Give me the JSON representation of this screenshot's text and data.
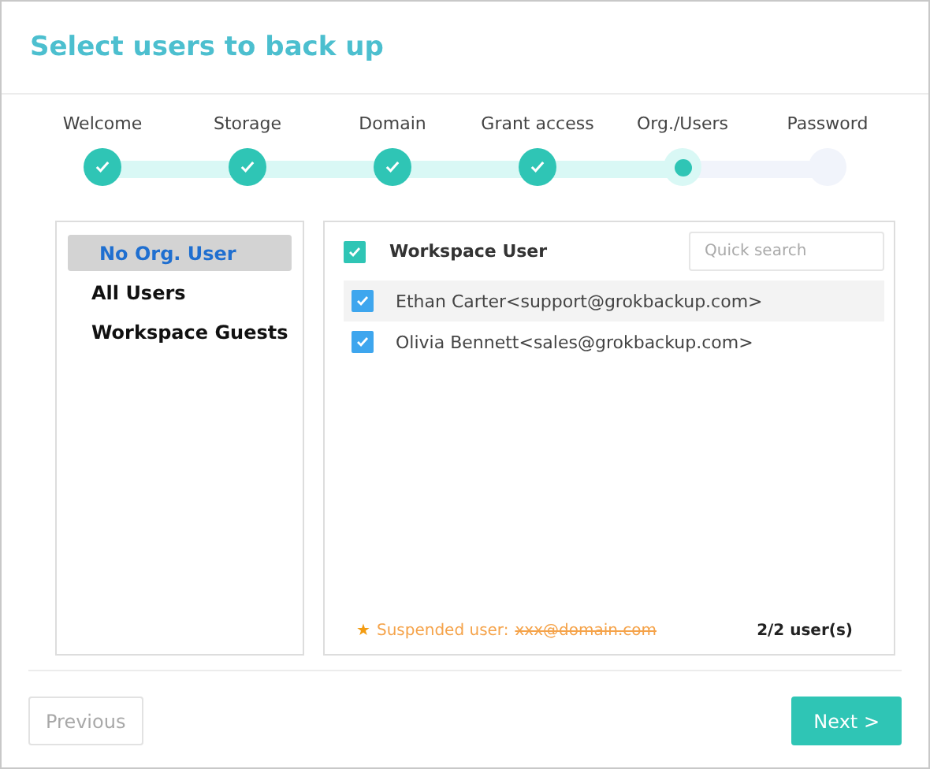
{
  "title": "Select users to back up",
  "steps": [
    {
      "label": "Welcome",
      "kind": "done"
    },
    {
      "label": "Storage",
      "kind": "done"
    },
    {
      "label": "Domain",
      "kind": "done"
    },
    {
      "label": "Grant access",
      "kind": "done"
    },
    {
      "label": "Org./Users",
      "kind": "current"
    },
    {
      "label": "Password",
      "kind": "pending"
    }
  ],
  "sidebar": {
    "items": [
      {
        "label": "No Org. User",
        "selected": true
      },
      {
        "label": "All Users",
        "selected": false
      },
      {
        "label": "Workspace Guests",
        "selected": false
      }
    ]
  },
  "user_list": {
    "header": {
      "label": "Workspace User",
      "checked": true
    },
    "search": {
      "placeholder": "Quick search"
    },
    "rows": [
      {
        "label": "Ethan Carter<support@grokbackup.com>",
        "checked": true,
        "highlighted": true
      },
      {
        "label": "Olivia Bennett<sales@grokbackup.com>",
        "checked": true,
        "highlighted": false
      }
    ],
    "legend": {
      "star": "★",
      "label": "Suspended user:",
      "example": "xxx@domain.com"
    },
    "count": "2/2 user(s)"
  },
  "buttons": {
    "previous": {
      "label": "Previous",
      "disabled": true
    },
    "next": {
      "label": "Next >",
      "disabled": false
    }
  }
}
